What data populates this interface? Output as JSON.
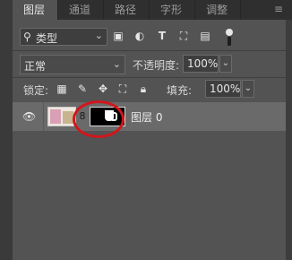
{
  "tabs": [
    "图层",
    "通道",
    "路径",
    "字形",
    "调整"
  ],
  "menu_icon": "hamburger-icon",
  "filter": {
    "label": "类型",
    "icons": [
      "image-filter-icon",
      "adjustment-filter-icon",
      "type-filter-icon",
      "shape-filter-icon",
      "smart-object-filter-icon"
    ]
  },
  "blend": {
    "mode": "正常",
    "opacity_label": "不透明度:",
    "opacity_value": "100%"
  },
  "lock": {
    "label": "锁定:",
    "icons": [
      "lock-transparent-icon",
      "lock-image-icon",
      "lock-position-icon",
      "lock-artboard-icon",
      "lock-all-icon"
    ],
    "fill_label": "填充:",
    "fill_value": "100%"
  },
  "layer": {
    "name": "图层 0",
    "visible": true,
    "colors": {
      "highlight": "#d1161c"
    }
  }
}
